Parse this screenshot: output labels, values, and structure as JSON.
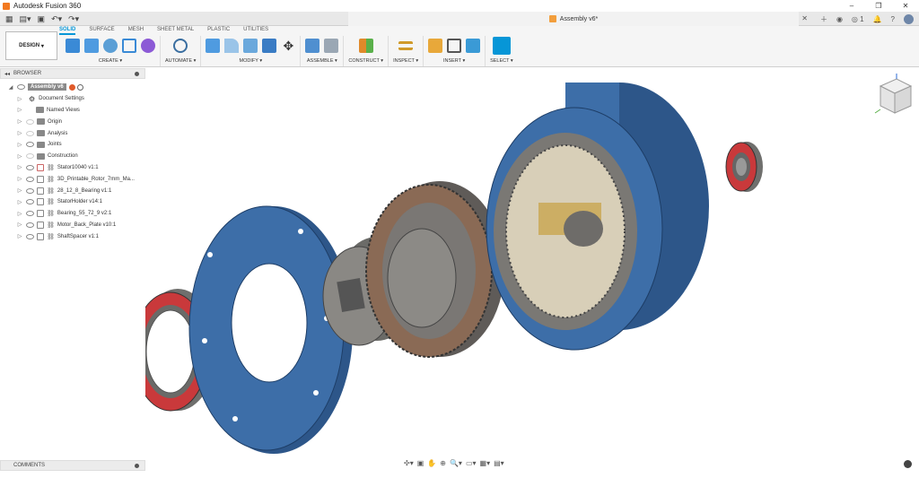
{
  "window": {
    "title": "Autodesk Fusion 360",
    "controls": [
      "–",
      "❐",
      "✕"
    ]
  },
  "tabbar": {
    "document_title": "Assembly v6*",
    "close_label": "✕",
    "notification_count": "1"
  },
  "ribbon": {
    "workspace": "DESIGN",
    "tabs": [
      {
        "label": "SOLID",
        "active": true
      },
      {
        "label": "SURFACE",
        "active": false
      },
      {
        "label": "MESH",
        "active": false
      },
      {
        "label": "SHEET METAL",
        "active": false
      },
      {
        "label": "PLASTIC",
        "active": false
      },
      {
        "label": "UTILITIES",
        "active": false
      }
    ],
    "groups": [
      {
        "label": "CREATE ▾"
      },
      {
        "label": "AUTOMATE ▾"
      },
      {
        "label": "MODIFY ▾"
      },
      {
        "label": "ASSEMBLE ▾"
      },
      {
        "label": "CONSTRUCT ▾"
      },
      {
        "label": "INSPECT ▾"
      },
      {
        "label": "INSERT ▾"
      },
      {
        "label": "SELECT ▾"
      }
    ]
  },
  "browser": {
    "title": "BROWSER",
    "root": "Assembly v6",
    "items": [
      {
        "label": "Document Settings",
        "kind": "settings"
      },
      {
        "label": "Named Views",
        "kind": "folder"
      },
      {
        "label": "Origin",
        "kind": "folder"
      },
      {
        "label": "Analysis",
        "kind": "folder"
      },
      {
        "label": "Joints",
        "kind": "folder"
      },
      {
        "label": "Construction",
        "kind": "folder"
      },
      {
        "label": "Stator10040 v1:1",
        "kind": "component"
      },
      {
        "label": "3D_Printable_Rotor_7mm_Ma...",
        "kind": "component"
      },
      {
        "label": "28_12_8_Bearing v1:1",
        "kind": "component"
      },
      {
        "label": "StatorHolder v14:1",
        "kind": "component"
      },
      {
        "label": "Bearing_55_72_9 v2:1",
        "kind": "component"
      },
      {
        "label": "Motor_Back_Plate v10:1",
        "kind": "component"
      },
      {
        "label": "ShaftSpacer v1:1",
        "kind": "component"
      }
    ]
  },
  "comments": {
    "title": "COMMENTS"
  },
  "colors": {
    "part_blue": "#3d6ea8",
    "part_gray": "#7a7a78",
    "bearing_red": "#c9393b",
    "accent": "#0696d7"
  }
}
